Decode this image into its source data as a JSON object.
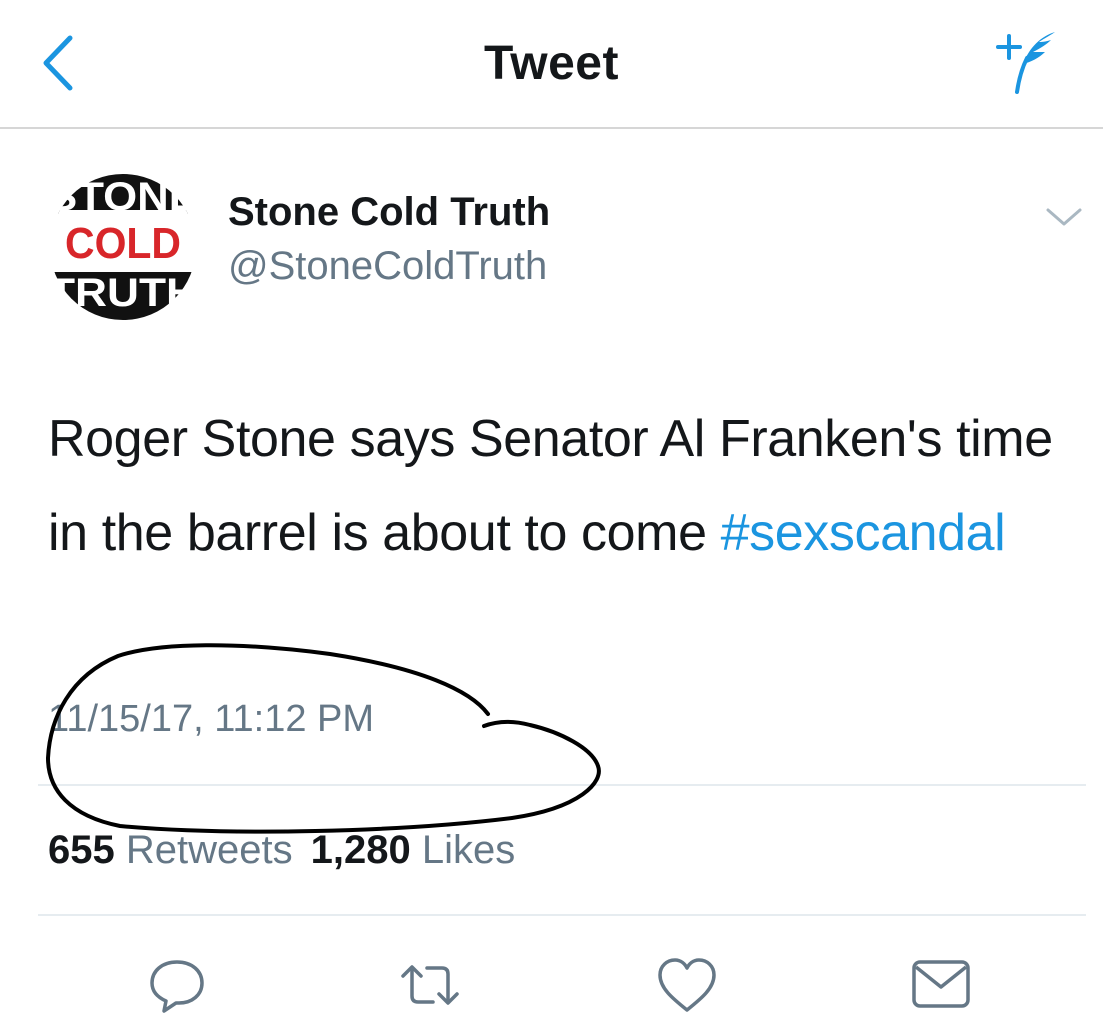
{
  "nav": {
    "title": "Tweet",
    "back_icon": "chevron-left-icon",
    "compose_icon": "compose-tweet-icon"
  },
  "author": {
    "display_name": "Stone Cold Truth",
    "handle": "@StoneColdTruth",
    "avatar_logo": {
      "line1": "STONE",
      "line2": "COLD",
      "line3": "TRUTH"
    }
  },
  "tweet": {
    "text_before": "Roger Stone says Senator Al Franken's time in the barrel is about to come ",
    "hashtag": "#sexscandal",
    "timestamp": "11/15/17, 11:12 PM"
  },
  "stats": {
    "retweets_count": "655",
    "retweets_label": "Retweets",
    "likes_count": "1,280",
    "likes_label": "Likes"
  },
  "actions": {
    "reply_icon": "reply-icon",
    "retweet_icon": "retweet-icon",
    "like_icon": "heart-icon",
    "message_icon": "envelope-icon"
  },
  "colors": {
    "accent": "#1b95e0",
    "secondary_text": "#657786",
    "divider": "#e6ecf0",
    "logo_red": "#d8262a"
  }
}
